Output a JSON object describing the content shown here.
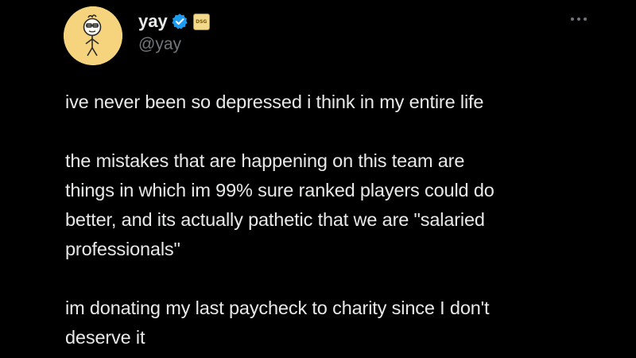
{
  "author": {
    "display_name": "yay",
    "handle": "@yay",
    "affiliation_badge": "DSG",
    "avatar_icon": "stick-figure-avatar-icon",
    "verified_icon": "verified-badge-icon"
  },
  "menu": {
    "more_icon": "more-options-icon"
  },
  "tweet": {
    "paragraphs": [
      "ive never been so depressed i think in my entire life",
      "the mistakes that are happening on this team are\nthings in which im 99% sure ranked players could do\nbetter, and its actually pathetic that we are \"salaried\nprofessionals\"",
      "im donating my last paycheck to charity since I don't\ndeserve it"
    ]
  },
  "colors": {
    "background": "#000000",
    "text": "#e7e9ea",
    "secondary_text": "#71767b",
    "verified_blue": "#1d9bf0",
    "avatar_bg": "#f6d47e"
  }
}
